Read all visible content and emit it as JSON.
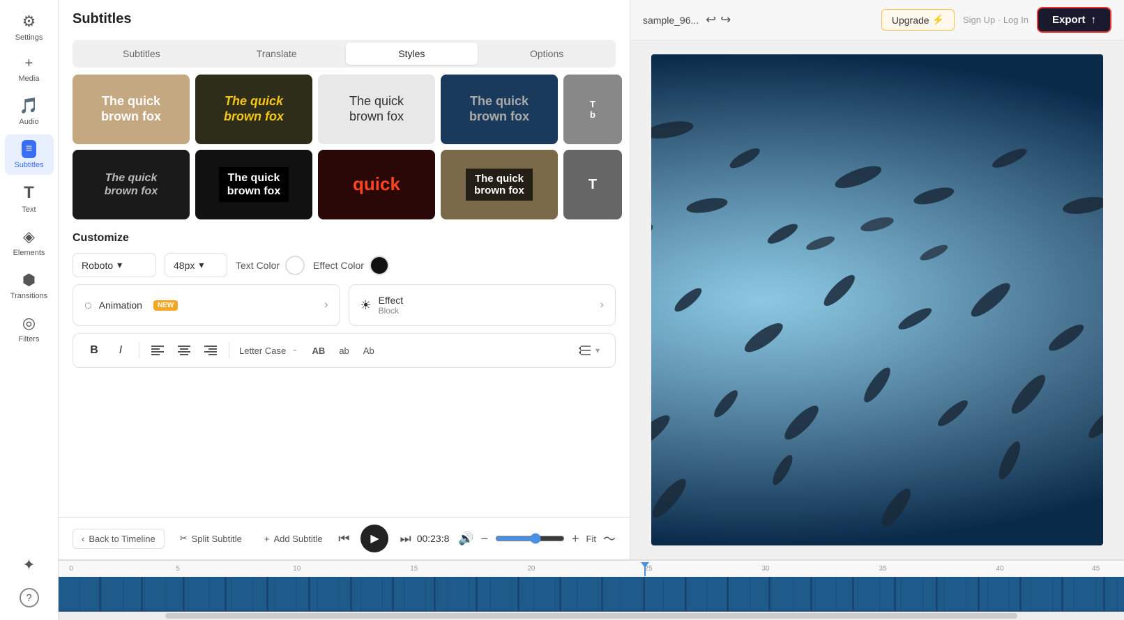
{
  "sidebar": {
    "items": [
      {
        "id": "settings",
        "label": "Settings",
        "icon": "⚙"
      },
      {
        "id": "media",
        "label": "Media",
        "icon": "+"
      },
      {
        "id": "audio",
        "label": "Audio",
        "icon": "♪"
      },
      {
        "id": "subtitles",
        "label": "Subtitles",
        "icon": "≡",
        "active": true
      },
      {
        "id": "text",
        "label": "Text",
        "icon": "T"
      },
      {
        "id": "elements",
        "label": "Elements",
        "icon": "◈"
      },
      {
        "id": "transitions",
        "label": "Transitions",
        "icon": "▶"
      },
      {
        "id": "filters",
        "label": "Filters",
        "icon": "◎"
      },
      {
        "id": "sparkle",
        "label": "",
        "icon": "✦"
      },
      {
        "id": "help",
        "label": "",
        "icon": "?"
      }
    ]
  },
  "panel": {
    "title": "Subtitles",
    "tabs": [
      {
        "id": "subtitles",
        "label": "Subtitles"
      },
      {
        "id": "translate",
        "label": "Translate"
      },
      {
        "id": "styles",
        "label": "Styles",
        "active": true
      },
      {
        "id": "options",
        "label": "Options"
      }
    ],
    "style_cards": [
      {
        "id": 1,
        "text": "The quick brown fox",
        "style": "card-1"
      },
      {
        "id": 2,
        "text": "The quick brown fox",
        "style": "card-2"
      },
      {
        "id": 3,
        "text": "The quick brown fox",
        "style": "card-3"
      },
      {
        "id": 4,
        "text": "The quick brown fox",
        "style": "card-4"
      },
      {
        "id": 5,
        "text": "T b",
        "style": "card-5"
      },
      {
        "id": 6,
        "text": "The quick brown fox",
        "style": "card-6"
      },
      {
        "id": 7,
        "text": "The quick brown fox",
        "style": "card-7"
      },
      {
        "id": 8,
        "text": "quick",
        "style": "card-8"
      },
      {
        "id": 9,
        "text": "The quick brown fox",
        "style": "card-9"
      },
      {
        "id": 10,
        "text": "T",
        "style": "card-10"
      }
    ],
    "customize": {
      "title": "Customize",
      "font": "Roboto",
      "font_size": "48px",
      "text_color_label": "Text Color",
      "effect_color_label": "Effect Color",
      "animation_label": "Animation",
      "animation_badge": "NEW",
      "effect_label": "Effect",
      "effect_sublabel": "Block",
      "format_buttons": [
        {
          "id": "bold",
          "icon": "B",
          "label": "Bold"
        },
        {
          "id": "italic",
          "icon": "I",
          "label": "Italic"
        },
        {
          "id": "align-left",
          "icon": "≡",
          "label": "Align Left"
        },
        {
          "id": "align-center",
          "icon": "≡",
          "label": "Align Center"
        },
        {
          "id": "align-right",
          "icon": "≡",
          "label": "Align Right"
        }
      ],
      "letter_case_label": "Letter Case",
      "letter_case_dash": "-",
      "lc_options": [
        "AB",
        "ab",
        "Ab"
      ],
      "spacing_icon": "↕"
    }
  },
  "timeline": {
    "back_label": "Back to Timeline",
    "split_label": "Split Subtitle",
    "add_label": "Add Subtitle",
    "timecode": "00:23:8",
    "fit_label": "Fit",
    "ruler_marks": [
      0,
      5,
      10,
      15,
      20,
      25,
      30,
      35,
      40,
      45
    ],
    "playhead_position": "63"
  },
  "header": {
    "filename": "sample_96...",
    "upgrade_label": "Upgrade",
    "signin_label": "Sign Up",
    "login_label": "Log In",
    "export_label": "Export"
  }
}
